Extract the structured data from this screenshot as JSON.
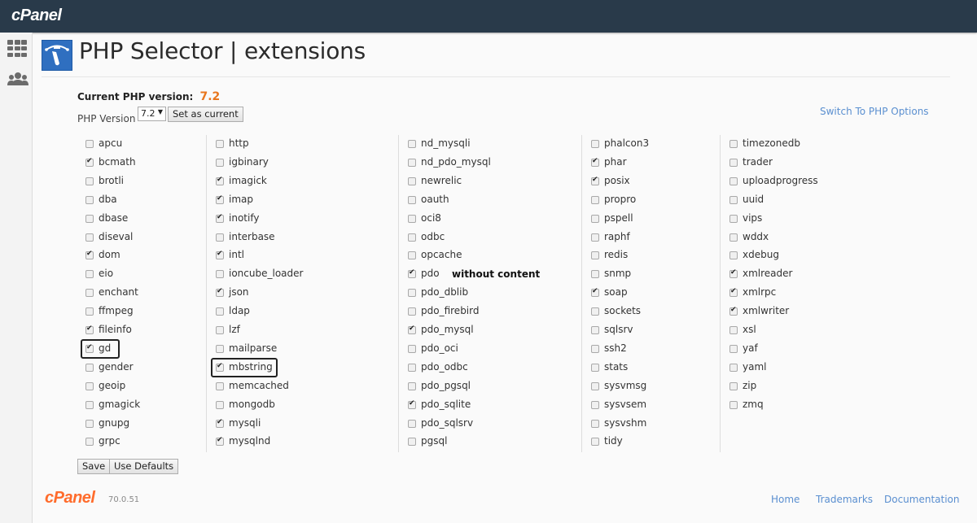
{
  "header": {
    "logo": "cPanel"
  },
  "sidebar": {
    "icons": [
      "grid-icon",
      "users-icon"
    ]
  },
  "page": {
    "title": "PHP Selector | extensions",
    "current_version_label": "Current PHP version:",
    "current_version": "7.2",
    "php_version_label": "PHP Version",
    "selected_version": "7.2",
    "set_current_label": "Set as current",
    "switch_link": "Switch To PHP Options",
    "annotation": "without content",
    "save_label": "Save",
    "defaults_label": "Use Defaults"
  },
  "colors": {
    "accent_orange": "#e8761e",
    "link_blue": "#5a8fd0",
    "topbar": "#293a4a"
  },
  "columns": [
    [
      {
        "name": "apcu",
        "checked": false
      },
      {
        "name": "bcmath",
        "checked": true
      },
      {
        "name": "brotli",
        "checked": false
      },
      {
        "name": "dba",
        "checked": false
      },
      {
        "name": "dbase",
        "checked": false
      },
      {
        "name": "diseval",
        "checked": false
      },
      {
        "name": "dom",
        "checked": true
      },
      {
        "name": "eio",
        "checked": false
      },
      {
        "name": "enchant",
        "checked": false
      },
      {
        "name": "ffmpeg",
        "checked": false
      },
      {
        "name": "fileinfo",
        "checked": true
      },
      {
        "name": "gd",
        "checked": true,
        "highlighted": true
      },
      {
        "name": "gender",
        "checked": false
      },
      {
        "name": "geoip",
        "checked": false
      },
      {
        "name": "gmagick",
        "checked": false
      },
      {
        "name": "gnupg",
        "checked": false
      },
      {
        "name": "grpc",
        "checked": false
      }
    ],
    [
      {
        "name": "http",
        "checked": false
      },
      {
        "name": "igbinary",
        "checked": false
      },
      {
        "name": "imagick",
        "checked": true
      },
      {
        "name": "imap",
        "checked": true
      },
      {
        "name": "inotify",
        "checked": true
      },
      {
        "name": "interbase",
        "checked": false
      },
      {
        "name": "intl",
        "checked": true
      },
      {
        "name": "ioncube_loader",
        "checked": false
      },
      {
        "name": "json",
        "checked": true
      },
      {
        "name": "ldap",
        "checked": false
      },
      {
        "name": "lzf",
        "checked": false
      },
      {
        "name": "mailparse",
        "checked": false
      },
      {
        "name": "mbstring",
        "checked": true,
        "highlighted": true
      },
      {
        "name": "memcached",
        "checked": false
      },
      {
        "name": "mongodb",
        "checked": false
      },
      {
        "name": "mysqli",
        "checked": true
      },
      {
        "name": "mysqlnd",
        "checked": true
      }
    ],
    [
      {
        "name": "nd_mysqli",
        "checked": false
      },
      {
        "name": "nd_pdo_mysql",
        "checked": false
      },
      {
        "name": "newrelic",
        "checked": false
      },
      {
        "name": "oauth",
        "checked": false
      },
      {
        "name": "oci8",
        "checked": false
      },
      {
        "name": "odbc",
        "checked": false
      },
      {
        "name": "opcache",
        "checked": false
      },
      {
        "name": "pdo",
        "checked": true
      },
      {
        "name": "pdo_dblib",
        "checked": false
      },
      {
        "name": "pdo_firebird",
        "checked": false
      },
      {
        "name": "pdo_mysql",
        "checked": true
      },
      {
        "name": "pdo_oci",
        "checked": false
      },
      {
        "name": "pdo_odbc",
        "checked": false
      },
      {
        "name": "pdo_pgsql",
        "checked": false
      },
      {
        "name": "pdo_sqlite",
        "checked": true
      },
      {
        "name": "pdo_sqlsrv",
        "checked": false
      },
      {
        "name": "pgsql",
        "checked": false
      }
    ],
    [
      {
        "name": "phalcon3",
        "checked": false
      },
      {
        "name": "phar",
        "checked": true
      },
      {
        "name": "posix",
        "checked": true
      },
      {
        "name": "propro",
        "checked": false
      },
      {
        "name": "pspell",
        "checked": false
      },
      {
        "name": "raphf",
        "checked": false
      },
      {
        "name": "redis",
        "checked": false
      },
      {
        "name": "snmp",
        "checked": false
      },
      {
        "name": "soap",
        "checked": true
      },
      {
        "name": "sockets",
        "checked": false
      },
      {
        "name": "sqlsrv",
        "checked": false
      },
      {
        "name": "ssh2",
        "checked": false
      },
      {
        "name": "stats",
        "checked": false
      },
      {
        "name": "sysvmsg",
        "checked": false
      },
      {
        "name": "sysvsem",
        "checked": false
      },
      {
        "name": "sysvshm",
        "checked": false
      },
      {
        "name": "tidy",
        "checked": false
      }
    ],
    [
      {
        "name": "timezonedb",
        "checked": false
      },
      {
        "name": "trader",
        "checked": false
      },
      {
        "name": "uploadprogress",
        "checked": false
      },
      {
        "name": "uuid",
        "checked": false
      },
      {
        "name": "vips",
        "checked": false
      },
      {
        "name": "wddx",
        "checked": false
      },
      {
        "name": "xdebug",
        "checked": false
      },
      {
        "name": "xmlreader",
        "checked": true
      },
      {
        "name": "xmlrpc",
        "checked": true
      },
      {
        "name": "xmlwriter",
        "checked": true
      },
      {
        "name": "xsl",
        "checked": false
      },
      {
        "name": "yaf",
        "checked": false
      },
      {
        "name": "yaml",
        "checked": false
      },
      {
        "name": "zip",
        "checked": false
      },
      {
        "name": "zmq",
        "checked": false
      }
    ]
  ],
  "footer": {
    "logo": "cPanel",
    "version": "70.0.51",
    "links": [
      "Home",
      "Trademarks",
      "Documentation"
    ]
  }
}
